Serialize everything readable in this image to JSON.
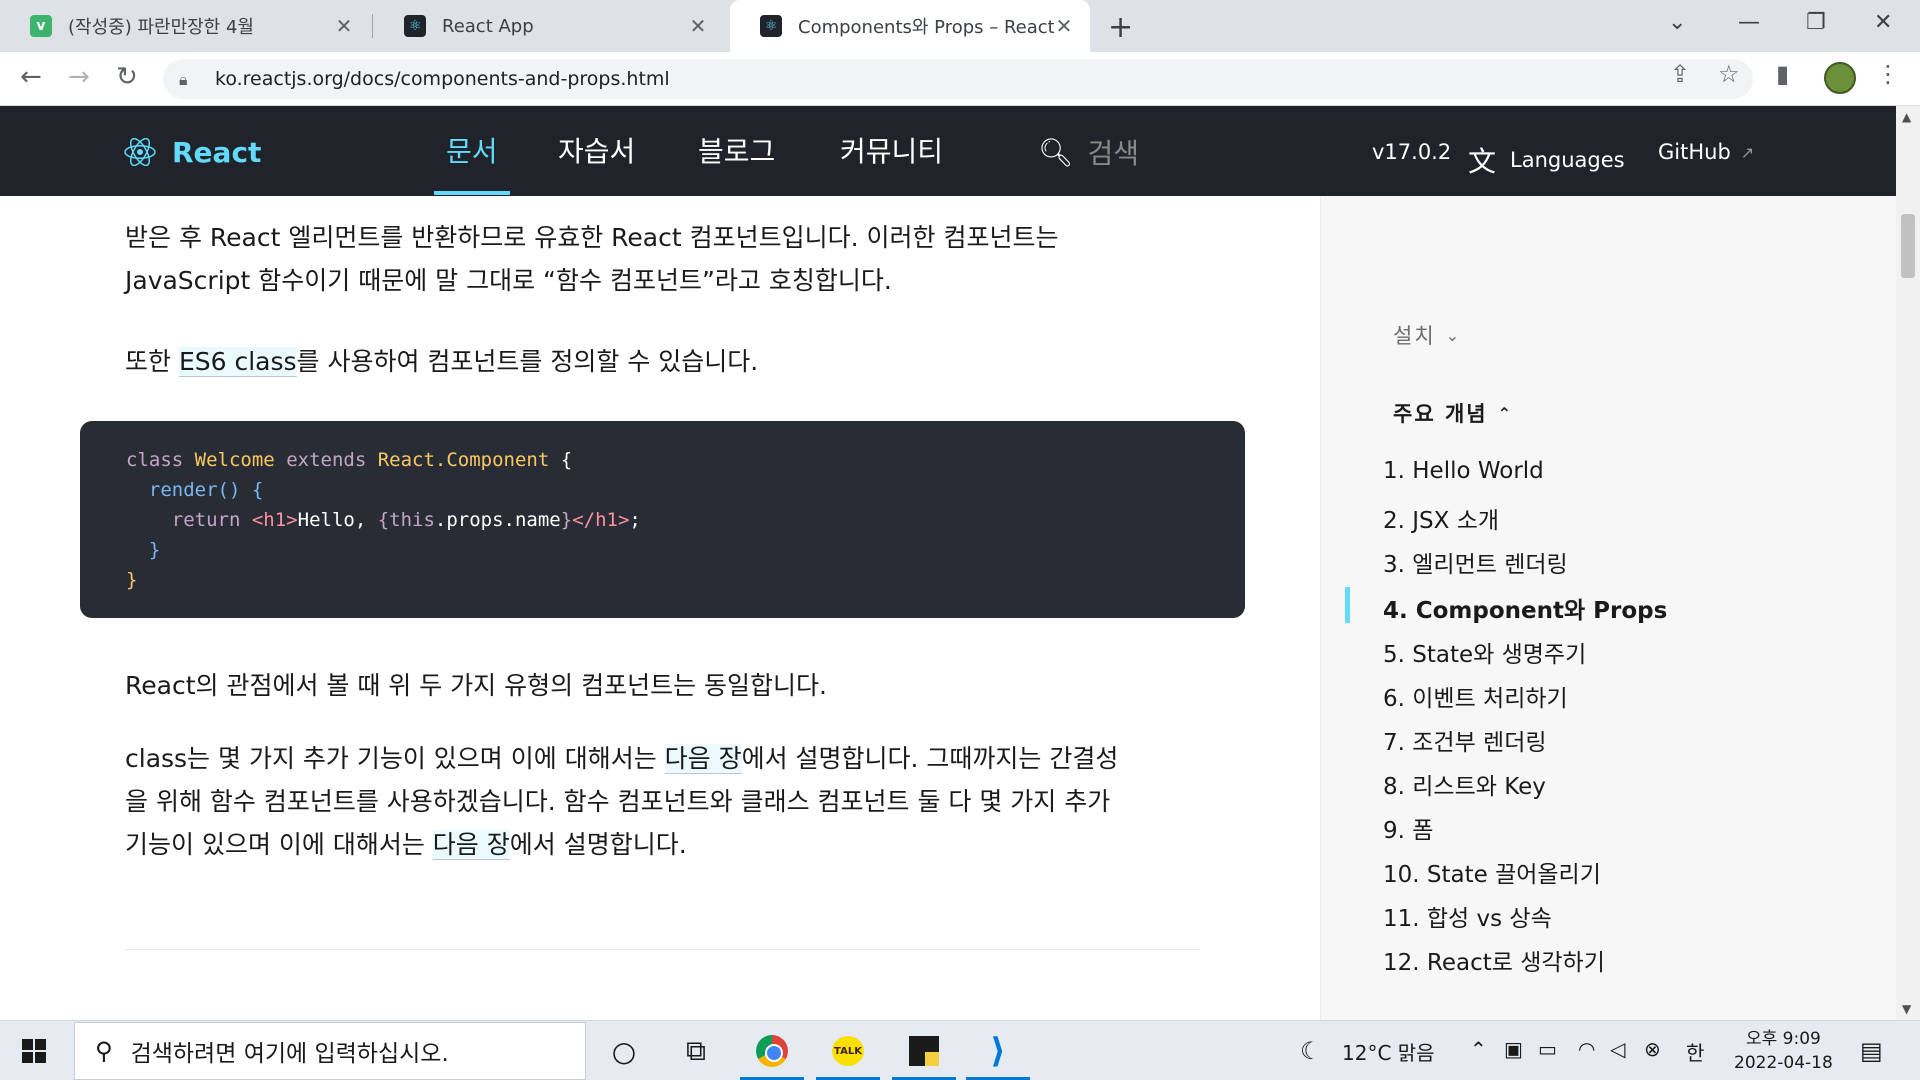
{
  "browser": {
    "tabs": [
      {
        "favicon": "v",
        "title": "(작성중) 파란만장한 4월"
      },
      {
        "favicon": "react",
        "title": "React App"
      },
      {
        "favicon": "react",
        "title": "Components와 Props – React"
      }
    ],
    "active_tab": 2,
    "url": "ko.reactjs.org/docs/components-and-props.html"
  },
  "header": {
    "logo": "React",
    "nav": [
      "문서",
      "자습서",
      "블로그",
      "커뮤니티"
    ],
    "search_placeholder": "검색",
    "version": "v17.0.2",
    "languages": "Languages",
    "github": "GitHub"
  },
  "content": {
    "p1_line1": "받은 후 React 엘리먼트를 반환하므로 유효한 React 컴포넌트입니다. 이러한 컴포넌트는",
    "p1_line2": "JavaScript 함수이기 때문에 말 그대로 “함수 컴포넌트”라고 호칭합니다.",
    "p2_pre": "또한 ",
    "p2_link": "ES6 class",
    "p2_post": "를 사용하여 컴포넌트를 정의할 수 있습니다.",
    "code": {
      "l1_kw1": "class",
      "l1_cls": "Welcome",
      "l1_kw2": "extends",
      "l1_base": "React.Component",
      "l1_brace": "{",
      "l2_fn": "render",
      "l2_rest": "() {",
      "l3_ret": "return",
      "l3_open": "<h1>",
      "l3_text": "Hello, ",
      "l3_expr_open": "{",
      "l3_this": "this",
      "l3_props": ".props.name",
      "l3_expr_close": "}",
      "l3_close": "</h1>",
      "l3_semi": ";",
      "l4": "}",
      "l5": "}"
    },
    "p3": "React의 관점에서 볼 때 위 두 가지 유형의 컴포넌트는 동일합니다.",
    "p4_a": "class는 몇 가지 추가 기능이 있으며 이에 대해서는 ",
    "p4_link1": "다음 장",
    "p4_b": "에서 설명합니다. 그때까지는 간결성",
    "p4_c": "을 위해 함수 컴포넌트를 사용하겠습니다. 함수 컴포넌트와 클래스 컴포넌트 둘 다 몇 가지 추가",
    "p4_d": "기능이 있으며 이에 대해서는 ",
    "p4_link2": "다음 장",
    "p4_e": "에서 설명합니다."
  },
  "sidebar": {
    "section_install": "설치",
    "section_main": "주요 개념",
    "items": [
      "1. Hello World",
      "2. JSX 소개",
      "3. 엘리먼트 렌더링",
      "4. Component와 Props",
      "5. State와 생명주기",
      "6. 이벤트 처리하기",
      "7. 조건부 렌더링",
      "8. 리스트와 Key",
      "9. 폼",
      "10. State 끌어올리기",
      "11. 합성 vs 상속",
      "12. React로 생각하기"
    ],
    "current_index": 3
  },
  "taskbar": {
    "search_placeholder": "검색하려면 여기에 입력하십시오.",
    "kakao_label": "TALK",
    "weather": "12°C 맑음",
    "ime": "한",
    "time": "오후 9:09",
    "date": "2022-04-18"
  },
  "colors": {
    "react_blue": "#61dafb",
    "header_bg": "#20232a",
    "code_bg": "#282c34"
  }
}
